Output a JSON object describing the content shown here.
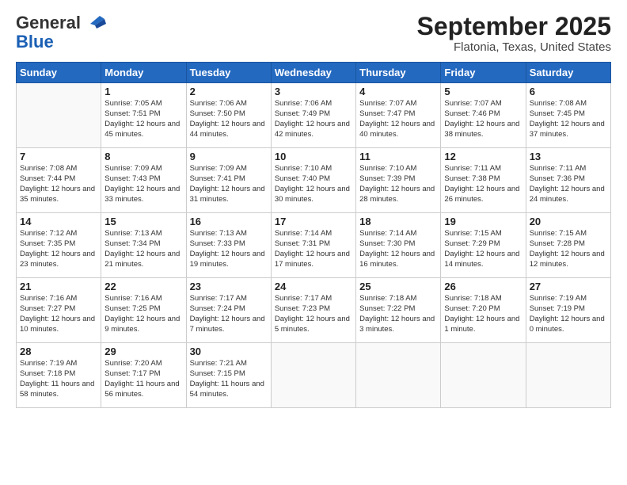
{
  "header": {
    "logo_general": "General",
    "logo_blue": "Blue",
    "title": "September 2025",
    "subtitle": "Flatonia, Texas, United States"
  },
  "days_of_week": [
    "Sunday",
    "Monday",
    "Tuesday",
    "Wednesday",
    "Thursday",
    "Friday",
    "Saturday"
  ],
  "weeks": [
    [
      {
        "num": "",
        "info": ""
      },
      {
        "num": "1",
        "info": "Sunrise: 7:05 AM\nSunset: 7:51 PM\nDaylight: 12 hours\nand 45 minutes."
      },
      {
        "num": "2",
        "info": "Sunrise: 7:06 AM\nSunset: 7:50 PM\nDaylight: 12 hours\nand 44 minutes."
      },
      {
        "num": "3",
        "info": "Sunrise: 7:06 AM\nSunset: 7:49 PM\nDaylight: 12 hours\nand 42 minutes."
      },
      {
        "num": "4",
        "info": "Sunrise: 7:07 AM\nSunset: 7:47 PM\nDaylight: 12 hours\nand 40 minutes."
      },
      {
        "num": "5",
        "info": "Sunrise: 7:07 AM\nSunset: 7:46 PM\nDaylight: 12 hours\nand 38 minutes."
      },
      {
        "num": "6",
        "info": "Sunrise: 7:08 AM\nSunset: 7:45 PM\nDaylight: 12 hours\nand 37 minutes."
      }
    ],
    [
      {
        "num": "7",
        "info": "Sunrise: 7:08 AM\nSunset: 7:44 PM\nDaylight: 12 hours\nand 35 minutes."
      },
      {
        "num": "8",
        "info": "Sunrise: 7:09 AM\nSunset: 7:43 PM\nDaylight: 12 hours\nand 33 minutes."
      },
      {
        "num": "9",
        "info": "Sunrise: 7:09 AM\nSunset: 7:41 PM\nDaylight: 12 hours\nand 31 minutes."
      },
      {
        "num": "10",
        "info": "Sunrise: 7:10 AM\nSunset: 7:40 PM\nDaylight: 12 hours\nand 30 minutes."
      },
      {
        "num": "11",
        "info": "Sunrise: 7:10 AM\nSunset: 7:39 PM\nDaylight: 12 hours\nand 28 minutes."
      },
      {
        "num": "12",
        "info": "Sunrise: 7:11 AM\nSunset: 7:38 PM\nDaylight: 12 hours\nand 26 minutes."
      },
      {
        "num": "13",
        "info": "Sunrise: 7:11 AM\nSunset: 7:36 PM\nDaylight: 12 hours\nand 24 minutes."
      }
    ],
    [
      {
        "num": "14",
        "info": "Sunrise: 7:12 AM\nSunset: 7:35 PM\nDaylight: 12 hours\nand 23 minutes."
      },
      {
        "num": "15",
        "info": "Sunrise: 7:13 AM\nSunset: 7:34 PM\nDaylight: 12 hours\nand 21 minutes."
      },
      {
        "num": "16",
        "info": "Sunrise: 7:13 AM\nSunset: 7:33 PM\nDaylight: 12 hours\nand 19 minutes."
      },
      {
        "num": "17",
        "info": "Sunrise: 7:14 AM\nSunset: 7:31 PM\nDaylight: 12 hours\nand 17 minutes."
      },
      {
        "num": "18",
        "info": "Sunrise: 7:14 AM\nSunset: 7:30 PM\nDaylight: 12 hours\nand 16 minutes."
      },
      {
        "num": "19",
        "info": "Sunrise: 7:15 AM\nSunset: 7:29 PM\nDaylight: 12 hours\nand 14 minutes."
      },
      {
        "num": "20",
        "info": "Sunrise: 7:15 AM\nSunset: 7:28 PM\nDaylight: 12 hours\nand 12 minutes."
      }
    ],
    [
      {
        "num": "21",
        "info": "Sunrise: 7:16 AM\nSunset: 7:27 PM\nDaylight: 12 hours\nand 10 minutes."
      },
      {
        "num": "22",
        "info": "Sunrise: 7:16 AM\nSunset: 7:25 PM\nDaylight: 12 hours\nand 9 minutes."
      },
      {
        "num": "23",
        "info": "Sunrise: 7:17 AM\nSunset: 7:24 PM\nDaylight: 12 hours\nand 7 minutes."
      },
      {
        "num": "24",
        "info": "Sunrise: 7:17 AM\nSunset: 7:23 PM\nDaylight: 12 hours\nand 5 minutes."
      },
      {
        "num": "25",
        "info": "Sunrise: 7:18 AM\nSunset: 7:22 PM\nDaylight: 12 hours\nand 3 minutes."
      },
      {
        "num": "26",
        "info": "Sunrise: 7:18 AM\nSunset: 7:20 PM\nDaylight: 12 hours\nand 1 minute."
      },
      {
        "num": "27",
        "info": "Sunrise: 7:19 AM\nSunset: 7:19 PM\nDaylight: 12 hours\nand 0 minutes."
      }
    ],
    [
      {
        "num": "28",
        "info": "Sunrise: 7:19 AM\nSunset: 7:18 PM\nDaylight: 11 hours\nand 58 minutes."
      },
      {
        "num": "29",
        "info": "Sunrise: 7:20 AM\nSunset: 7:17 PM\nDaylight: 11 hours\nand 56 minutes."
      },
      {
        "num": "30",
        "info": "Sunrise: 7:21 AM\nSunset: 7:15 PM\nDaylight: 11 hours\nand 54 minutes."
      },
      {
        "num": "",
        "info": ""
      },
      {
        "num": "",
        "info": ""
      },
      {
        "num": "",
        "info": ""
      },
      {
        "num": "",
        "info": ""
      }
    ]
  ]
}
